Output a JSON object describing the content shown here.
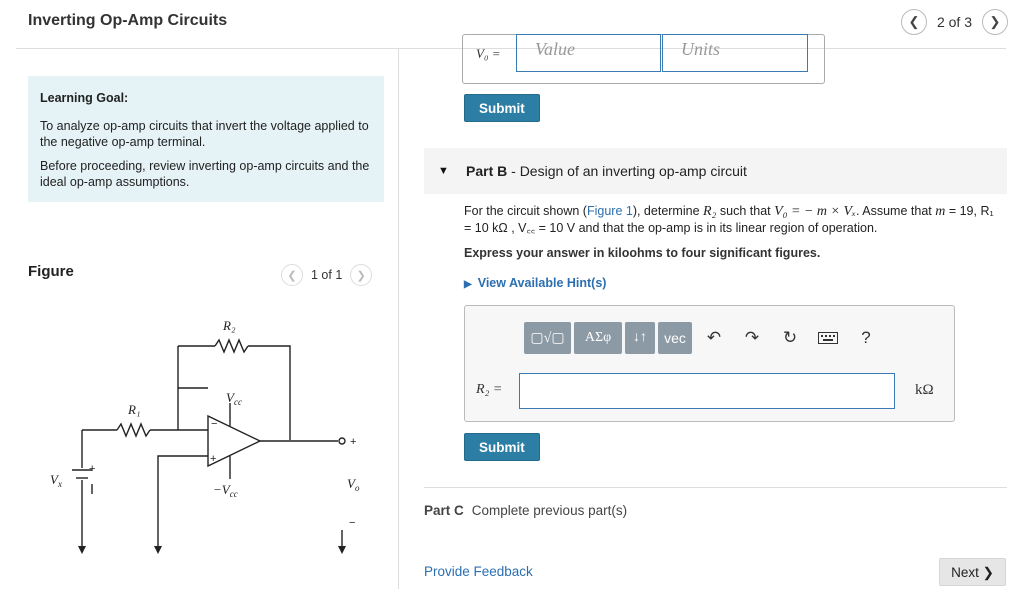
{
  "header": {
    "title": "Inverting Op-Amp Circuits",
    "pager": "2 of 3",
    "prev_icon": "chevron-left-icon",
    "next_icon": "chevron-right-icon"
  },
  "learning_goal": {
    "heading": "Learning Goal:",
    "p1": "To analyze op-amp circuits that invert the voltage applied to the negative op-amp terminal.",
    "p2": "Before proceeding, review inverting op-amp circuits and the ideal op-amp assumptions."
  },
  "figure": {
    "label": "Figure",
    "pager": "1 of 1",
    "labels": {
      "r2": "R₂",
      "r1": "R₁",
      "vcc": "V",
      "vcc_sub": "cc",
      "neg_vcc": "−V",
      "neg_vcc_sub": "cc",
      "vx": "V",
      "vx_sub": "x",
      "vo": "V",
      "vo_sub": "o",
      "plus": "+",
      "minus": "−"
    }
  },
  "part_a": {
    "label": "V₀ =",
    "value_placeholder": "Value",
    "units_placeholder": "Units",
    "submit": "Submit"
  },
  "part_b": {
    "label": "Part B",
    "title": "Design of an inverting op-amp circuit",
    "q_pre": "For the circuit shown (",
    "q_link": "Figure 1",
    "q_mid": "), determine ",
    "q_r2": "R₂",
    "q_such": " such that ",
    "q_eq": "V₀ = − m × Vₓ",
    "q_assume": ". Assume that ",
    "q_m": "m",
    "q_vals": " = 19, R₁ = 10 kΩ , V꜀꜀ = 10 V and that the op-amp is in its linear region of operation.",
    "express": "Express your answer in kiloohms to four significant figures.",
    "hints": "View Available Hint(s)",
    "toolbar": {
      "templates": "▢√▢",
      "greek": "ΑΣφ",
      "arrows": "↓↑",
      "vec": "vec",
      "undo_icon": "undo-icon",
      "redo_icon": "redo-icon",
      "reset_icon": "reset-icon",
      "keyboard_icon": "keyboard-icon",
      "help": "?"
    },
    "answer_label": "R₂ =",
    "unit": "kΩ",
    "submit": "Submit"
  },
  "part_c": {
    "label": "Part C",
    "text": "Complete previous part(s)"
  },
  "footer": {
    "feedback": "Provide Feedback",
    "next": "Next ❯"
  }
}
